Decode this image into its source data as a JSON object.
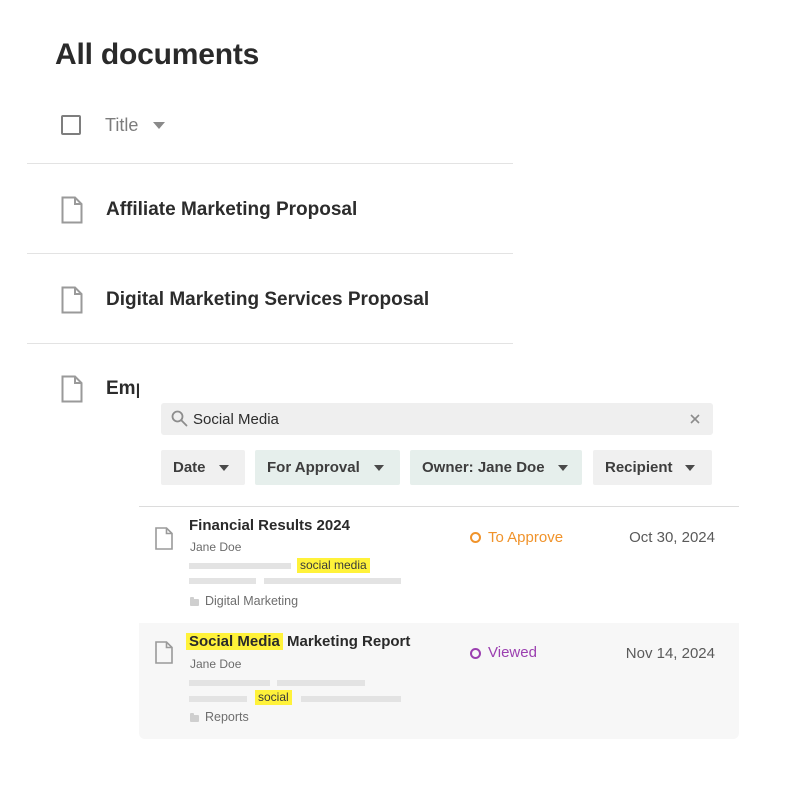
{
  "page_title": "All documents",
  "list": {
    "column_title": "Title",
    "documents": [
      {
        "title": "Affiliate Marketing Proposal"
      },
      {
        "title": "Digital Marketing Services Proposal"
      },
      {
        "title": "Emp"
      }
    ]
  },
  "search": {
    "query": "Social Media",
    "filters": [
      {
        "label": "Date",
        "active": false
      },
      {
        "label": "For Approval",
        "active": true
      },
      {
        "label": "Owner: Jane Doe",
        "active": true
      },
      {
        "label": "Recipient",
        "active": false
      }
    ],
    "results": [
      {
        "title_parts": {
          "highlight": "",
          "rest": "Financial Results 2024"
        },
        "owner": "Jane Doe",
        "snippet_highlight": "social media",
        "folder": "Digital Marketing",
        "status": "To Approve",
        "status_color": "#f0932b",
        "date": "Oct 30, 2024"
      },
      {
        "title_parts": {
          "highlight": "Social Media",
          "rest": " Marketing Report"
        },
        "owner": "Jane Doe",
        "snippet_highlight": "social",
        "folder": "Reports",
        "status": "Viewed",
        "status_color": "#9b3fb0",
        "date": "Nov 14, 2024"
      }
    ]
  },
  "colors": {
    "highlight": "#fff23a",
    "active_filter_bg": "#e6efec",
    "filter_bg": "#f0f0f0"
  }
}
